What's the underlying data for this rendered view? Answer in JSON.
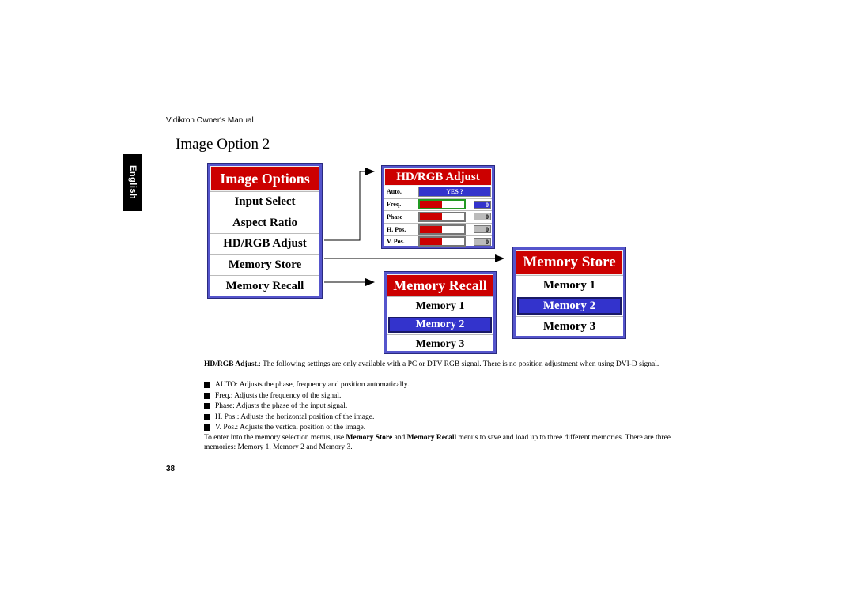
{
  "header": {
    "manual_title": "Vidikron Owner's Manual"
  },
  "side_tab": {
    "language": "English"
  },
  "page_title": "Image Option 2",
  "panels": {
    "image_options": {
      "title": "Image Options",
      "items": [
        "Input Select",
        "Aspect Ratio",
        "HD/RGB Adjust",
        "Memory Store",
        "Memory Recall"
      ]
    },
    "hdrgb_adjust": {
      "title": "HD/RGB Adjust",
      "auto": {
        "label": "Auto.",
        "value": "YES ?"
      },
      "rows": [
        {
          "label": "Freq.",
          "value": "0",
          "fill_percent": 50,
          "active": true
        },
        {
          "label": "Phase",
          "value": "0",
          "fill_percent": 50,
          "active": false
        },
        {
          "label": "H. Pos.",
          "value": "0",
          "fill_percent": 50,
          "active": false
        },
        {
          "label": "V. Pos.",
          "value": "0",
          "fill_percent": 50,
          "active": false
        }
      ]
    },
    "memory_recall": {
      "title": "Memory Recall",
      "items": [
        "Memory 1",
        "Memory 2",
        "Memory 3"
      ],
      "selected_index": 1
    },
    "memory_store": {
      "title": "Memory Store",
      "items": [
        "Memory 1",
        "Memory 2",
        "Memory 3"
      ],
      "selected_index": 1
    }
  },
  "body": {
    "intro_bold": "HD/RGB Adjust",
    "intro_text": ".: The following settings are only available with a PC or DTV RGB signal. There is no position adjustment when using DVI-D signal.",
    "bullets": [
      "AUTO: Adjusts the phase, frequency and position automatically.",
      "Freq.: Adjusts the frequency of the signal.",
      "Phase: Adjusts the phase of the input signal.",
      "H. Pos.: Adjusts the horizontal position of the image.",
      "V. Pos.: Adjusts the vertical position of the image."
    ],
    "memory_p1": "To enter into the memory selection menus, use ",
    "memory_bold1": "Memory Store",
    "memory_p2": " and ",
    "memory_bold2": "Memory Recall",
    "memory_p3": " menus to save and load up to three different memories. There are three memories: Memory 1, Memory 2 and Memory 3."
  },
  "page_number": "38",
  "colors": {
    "header_red": "#cc0000",
    "frame_blue": "#5555cc",
    "select_blue": "#3333cc"
  }
}
